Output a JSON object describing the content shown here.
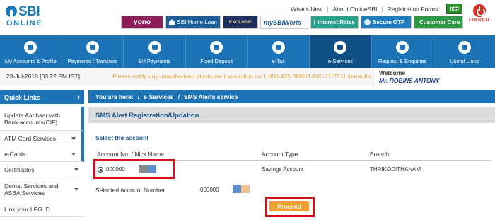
{
  "brand": {
    "primary": "#1c73b5",
    "dark": "#0f4f86",
    "alert": "#d0101a",
    "accent": "#f0a030",
    "logo_main": "SBI",
    "logo_sub": "ONLINE"
  },
  "toplinks": [
    "What's New",
    "About OnlineSBI",
    "Registration Forms"
  ],
  "hindi_label": "हिंदी",
  "logout_label": "LOGOUT",
  "banners": {
    "yono": "yono",
    "home_loan": "SBI Home Loan",
    "exclusif": "EXCLUSIF",
    "sbiworld": "mySBIWorld",
    "interest_rates": "Interest Rates",
    "secure_otp": "Secure OTP",
    "customer_care": "Customer Care"
  },
  "nav": [
    {
      "label": "My Accounts & Profile",
      "icon": "account-icon"
    },
    {
      "label": "Payments / Transfers",
      "icon": "payments-icon"
    },
    {
      "label": "Bill Payments",
      "icon": "bill-icon"
    },
    {
      "label": "Fixed Deposit",
      "icon": "deposit-icon"
    },
    {
      "label": "e-Tax",
      "icon": "tax-icon"
    },
    {
      "label": "e-Services",
      "icon": "eservices-icon",
      "active": true
    },
    {
      "label": "Request & Enquiries",
      "icon": "request-icon"
    },
    {
      "label": "Useful Links",
      "icon": "links-icon"
    }
  ],
  "datetime": "23-Jul-2018 [03:22 PM IST]",
  "notice": "Please notify any unauthorised electronic transaction on 1-800-425-3800/1-800-11-2211 immedia",
  "welcome": {
    "label": "Welcome",
    "name": "Mr. ROBINS ANTONY"
  },
  "sidebar": {
    "title": "Quick Links",
    "items": [
      {
        "label": "Update Aadhaar with Bank accounts(CIF)",
        "caret": false
      },
      {
        "label": "ATM Card Services",
        "caret": true
      },
      {
        "label": "e-Cards",
        "caret": true
      },
      {
        "label": "Certificates",
        "caret": true
      },
      {
        "label": "Demat Services and ASBA Services",
        "caret": true
      },
      {
        "label": "Link your LPG ID",
        "caret": false
      }
    ]
  },
  "breadcrumb": {
    "prefix": "You are here:",
    "sep": "/",
    "level1": "e-Services",
    "level2": "SMS Alerts service"
  },
  "section_title": "SMS Alert Registration/Updation",
  "select_label": "Select the account",
  "table": {
    "headers": [
      "Account No. / Nick Name",
      "Account Type",
      "Branch"
    ],
    "row": {
      "account": "000000",
      "type": "Savings Account",
      "branch": "THRIKODITHANAM"
    }
  },
  "selected_label": "Selected Account Number",
  "selected_value": "000000",
  "proceed_label": "Proceed"
}
